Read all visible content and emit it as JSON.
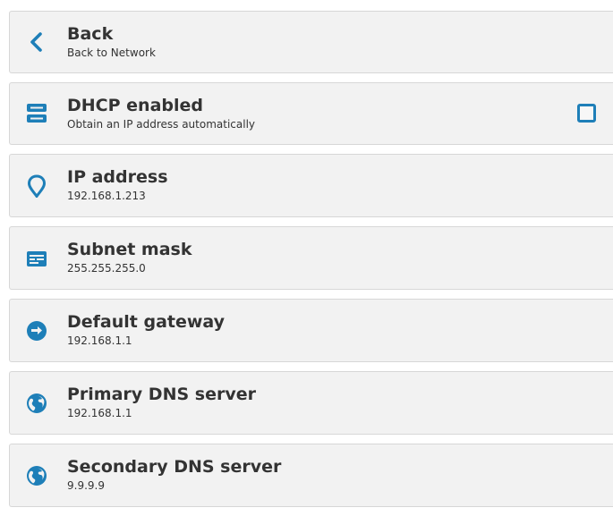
{
  "colors": {
    "accent": "#1e7fb8",
    "row_bg": "#f2f2f2",
    "border": "#d7d7d7",
    "text": "#333333"
  },
  "items": [
    {
      "icon": "chevron-left-icon",
      "title": "Back",
      "subtitle": "Back to Network"
    },
    {
      "icon": "server-icon",
      "title": "DHCP enabled",
      "subtitle": "Obtain an IP address automatically",
      "checked": false
    },
    {
      "icon": "location-pin-icon",
      "title": "IP address",
      "subtitle": "192.168.1.213"
    },
    {
      "icon": "network-card-icon",
      "title": "Subnet mask",
      "subtitle": "255.255.255.0"
    },
    {
      "icon": "gateway-icon",
      "title": "Default gateway",
      "subtitle": "192.168.1.1"
    },
    {
      "icon": "globe-icon",
      "title": "Primary DNS server",
      "subtitle": "192.168.1.1"
    },
    {
      "icon": "globe-icon",
      "title": "Secondary DNS server",
      "subtitle": "9.9.9.9"
    }
  ]
}
